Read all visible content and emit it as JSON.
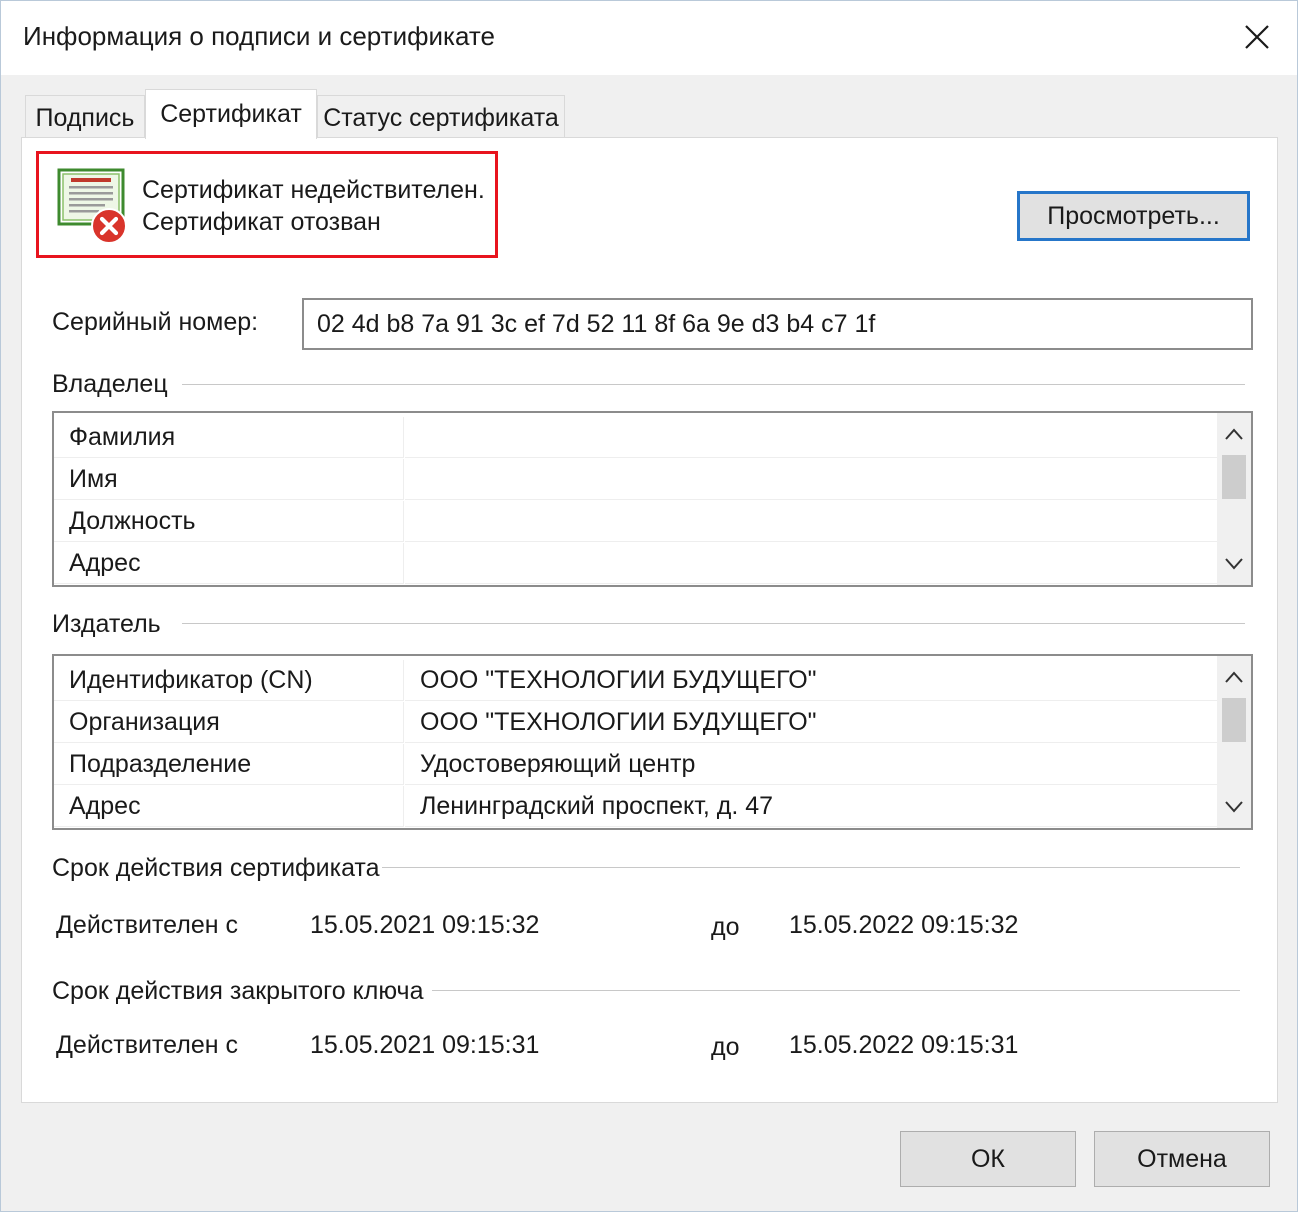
{
  "window": {
    "title": "Информация о подписи и сертификате"
  },
  "tabs": [
    {
      "label": "Подпись",
      "active": false
    },
    {
      "label": "Сертификат",
      "active": true
    },
    {
      "label": "Статус сертификата",
      "active": false
    }
  ],
  "status": {
    "line1": "Сертификат недействителен.",
    "line2": "Сертификат отозван",
    "icon": "certificate-revoked-icon",
    "highlight_color": "#e8141e"
  },
  "view_button_label": "Просмотреть...",
  "serial": {
    "label": "Серийный номер:",
    "value": "02 4d b8 7a 91 3c ef 7d 52 11 8f 6a 9e d3 b4 c7 1f"
  },
  "owner": {
    "heading": "Владелец",
    "rows": [
      {
        "key": "Фамилия",
        "value": ""
      },
      {
        "key": "Имя",
        "value": ""
      },
      {
        "key": "Должность",
        "value": ""
      },
      {
        "key": "Адрес",
        "value": ""
      }
    ]
  },
  "issuer": {
    "heading": "Издатель",
    "rows": [
      {
        "key": "Идентификатор (CN)",
        "value": "ООО \"ТЕХНОЛОГИИ БУДУЩЕГО\""
      },
      {
        "key": "Организация",
        "value": "ООО \"ТЕХНОЛОГИИ БУДУЩЕГО\""
      },
      {
        "key": "Подразделение",
        "value": "Удостоверяющий центр"
      },
      {
        "key": "Адрес",
        "value": "Ленинградский проспект, д. 47"
      }
    ]
  },
  "cert_validity": {
    "heading": "Срок действия сертификата",
    "from_label": "Действителен с",
    "from": "15.05.2021 09:15:32",
    "to_label": "до",
    "to": "15.05.2022 09:15:32"
  },
  "key_validity": {
    "heading": "Срок действия закрытого ключа",
    "from_label": "Действителен с",
    "from": "15.05.2021 09:15:31",
    "to_label": "до",
    "to": "15.05.2022 09:15:31"
  },
  "buttons": {
    "ok": "ОК",
    "cancel": "Отмена"
  }
}
